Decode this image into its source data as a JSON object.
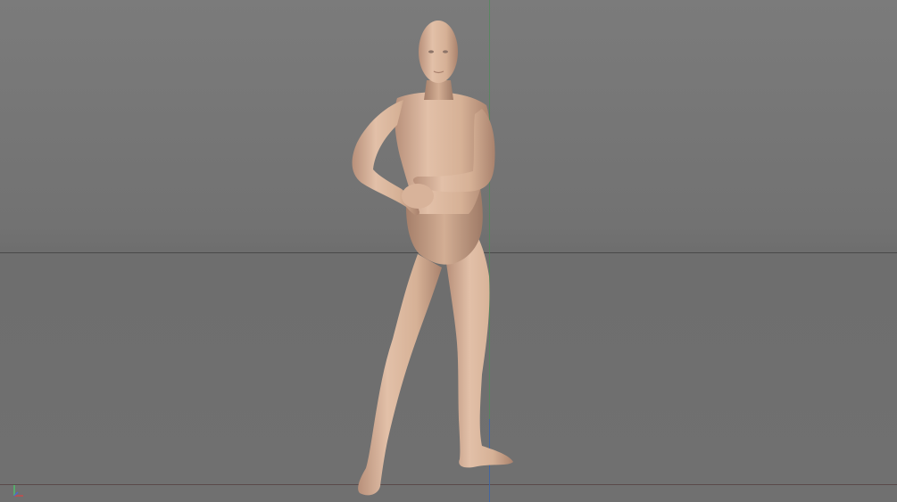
{
  "viewport": {
    "name": "3D viewport",
    "background_color": "#727272",
    "horizon_color": "#4a4a4a",
    "axis_colors": {
      "x": "#8a3a3a",
      "y": "#4f8a5a",
      "z": "#3f5fb0"
    },
    "figure_skin_color": "#d9b49c"
  }
}
